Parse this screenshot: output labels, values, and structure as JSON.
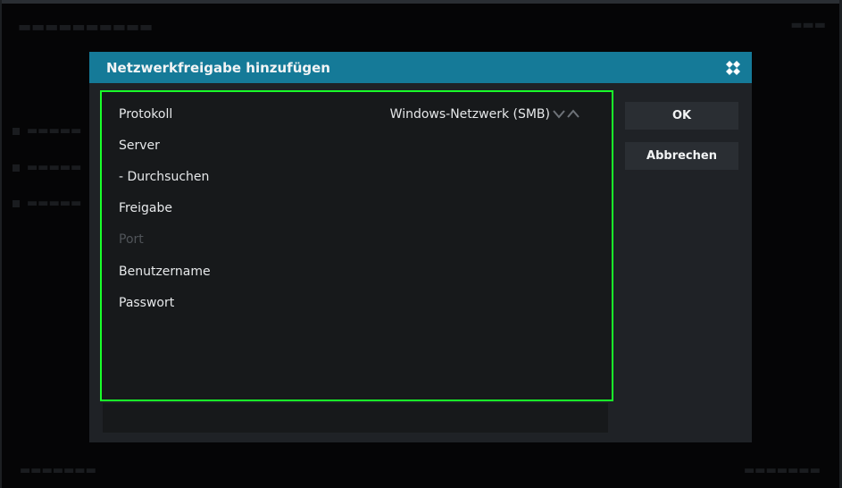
{
  "dialog": {
    "title": "Netzwerkfreigabe hinzufügen",
    "logo_icon": "kodi-logo-icon"
  },
  "rows": [
    {
      "label": "Protokoll",
      "value": "Windows-Netzwerk (SMB)",
      "enabled": true
    },
    {
      "label": "Server",
      "value": "",
      "enabled": true
    },
    {
      "label": "- Durchsuchen",
      "value": "",
      "enabled": true
    },
    {
      "label": "Freigabe",
      "value": "",
      "enabled": true
    },
    {
      "label": "Port",
      "value": "",
      "enabled": false
    },
    {
      "label": "Benutzername",
      "value": "",
      "enabled": true
    },
    {
      "label": "Passwort",
      "value": "",
      "enabled": true
    }
  ],
  "buttons": {
    "ok": "OK",
    "cancel": "Abbrechen"
  },
  "colors": {
    "header": "#157a98",
    "focus_border": "#19ff2a",
    "panel": "#17191b",
    "dialog": "#1f2226",
    "button": "#2a2e33"
  }
}
